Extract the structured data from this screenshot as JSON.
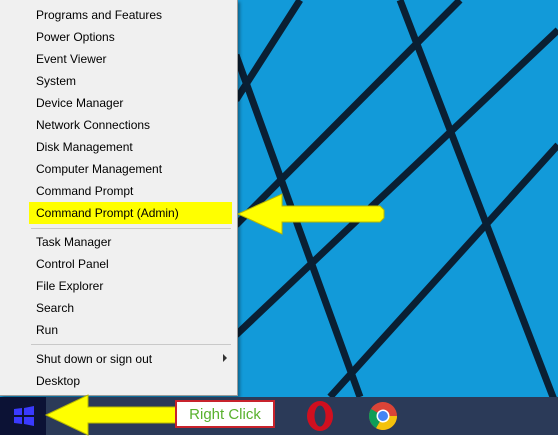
{
  "menu": {
    "items": [
      {
        "label": "Programs and Features"
      },
      {
        "label": "Power Options"
      },
      {
        "label": "Event Viewer"
      },
      {
        "label": "System"
      },
      {
        "label": "Device Manager"
      },
      {
        "label": "Network Connections"
      },
      {
        "label": "Disk Management"
      },
      {
        "label": "Computer Management"
      },
      {
        "label": "Command Prompt"
      },
      {
        "label": "Command Prompt (Admin)",
        "highlighted": true
      },
      {
        "label": "Task Manager"
      },
      {
        "label": "Control Panel"
      },
      {
        "label": "File Explorer"
      },
      {
        "label": "Search"
      },
      {
        "label": "Run"
      },
      {
        "label": "Shut down or sign out",
        "has_submenu": true
      },
      {
        "label": "Desktop"
      }
    ]
  },
  "callout": {
    "right_click_label": "Right Click"
  },
  "taskbar": {
    "icons": [
      "windows-start-icon",
      "opera-icon",
      "chrome-icon"
    ]
  },
  "colors": {
    "desktop": "#129ad9",
    "highlight": "#ffff00",
    "arrow": "#ffff00",
    "callout_border": "#c8232c",
    "callout_text": "#59b12e",
    "taskbar": "#2b3a58"
  }
}
